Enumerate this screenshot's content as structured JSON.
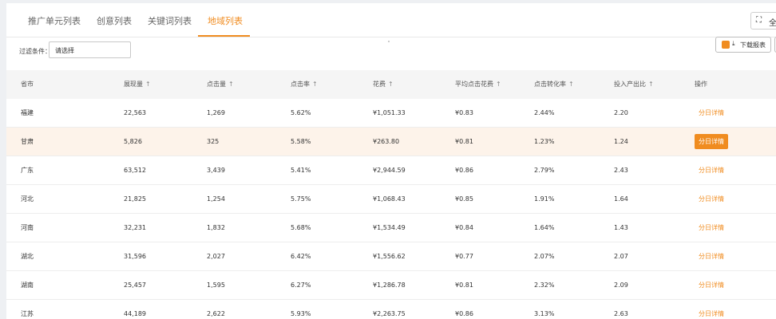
{
  "tabs": [
    {
      "label": "推广单元列表",
      "active": false
    },
    {
      "label": "创意列表",
      "active": false
    },
    {
      "label": "关键词列表",
      "active": false
    },
    {
      "label": "地域列表",
      "active": true
    }
  ],
  "fullscreen_label": "全",
  "filter": {
    "label": "过滤条件：",
    "value": "请选择"
  },
  "download_label": "下载报表",
  "colors": {
    "accent": "#f08c20"
  },
  "table": {
    "columns": [
      "省市",
      "展现量",
      "点击量",
      "点击率",
      "花费",
      "平均点击花费",
      "点击转化率",
      "投入产出比",
      "操作"
    ],
    "sort_mark": "↑",
    "action_label": "分日详情",
    "rows": [
      [
        "福建",
        "22,563",
        "1,269",
        "5.62%",
        "¥1,051.33",
        "¥0.83",
        "2.44%",
        "2.20"
      ],
      [
        "甘肃",
        "5,826",
        "325",
        "5.58%",
        "¥263.80",
        "¥0.81",
        "1.23%",
        "1.24"
      ],
      [
        "广东",
        "63,512",
        "3,439",
        "5.41%",
        "¥2,944.59",
        "¥0.86",
        "2.79%",
        "2.43"
      ],
      [
        "河北",
        "21,825",
        "1,254",
        "5.75%",
        "¥1,068.43",
        "¥0.85",
        "1.91%",
        "1.64"
      ],
      [
        "河南",
        "32,231",
        "1,832",
        "5.68%",
        "¥1,534.49",
        "¥0.84",
        "1.64%",
        "1.43"
      ],
      [
        "湖北",
        "31,596",
        "2,027",
        "6.42%",
        "¥1,556.62",
        "¥0.77",
        "2.07%",
        "2.07"
      ],
      [
        "湖南",
        "25,457",
        "1,595",
        "6.27%",
        "¥1,286.78",
        "¥0.81",
        "2.32%",
        "2.09"
      ],
      [
        "江苏",
        "44,189",
        "2,622",
        "5.93%",
        "¥2,263.75",
        "¥0.86",
        "3.13%",
        "2.63"
      ]
    ],
    "highlighted_row": 1
  }
}
